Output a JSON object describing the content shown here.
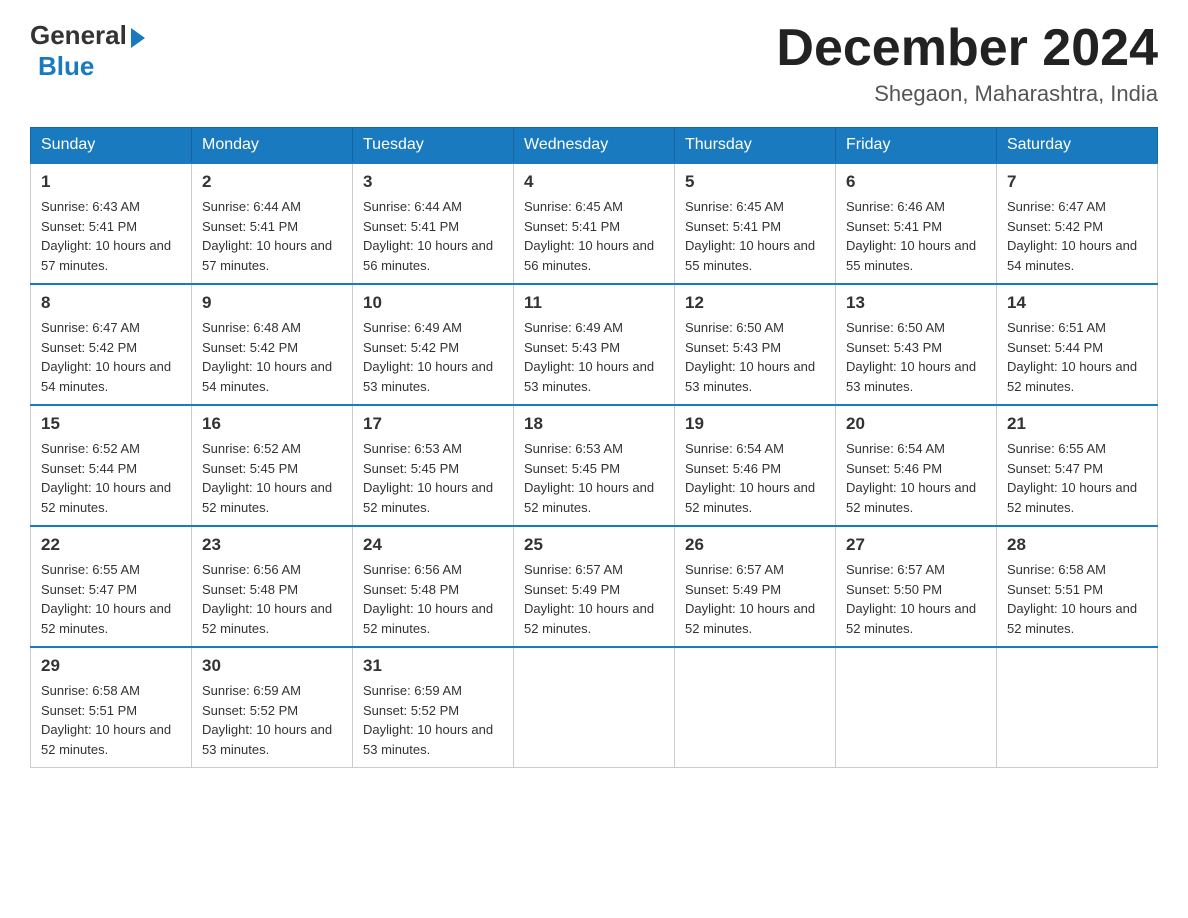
{
  "header": {
    "logo_general": "General",
    "logo_blue": "Blue",
    "title": "December 2024",
    "location": "Shegaon, Maharashtra, India"
  },
  "weekdays": [
    "Sunday",
    "Monday",
    "Tuesday",
    "Wednesday",
    "Thursday",
    "Friday",
    "Saturday"
  ],
  "weeks": [
    [
      {
        "day": "1",
        "sunrise": "6:43 AM",
        "sunset": "5:41 PM",
        "daylight": "10 hours and 57 minutes."
      },
      {
        "day": "2",
        "sunrise": "6:44 AM",
        "sunset": "5:41 PM",
        "daylight": "10 hours and 57 minutes."
      },
      {
        "day": "3",
        "sunrise": "6:44 AM",
        "sunset": "5:41 PM",
        "daylight": "10 hours and 56 minutes."
      },
      {
        "day": "4",
        "sunrise": "6:45 AM",
        "sunset": "5:41 PM",
        "daylight": "10 hours and 56 minutes."
      },
      {
        "day": "5",
        "sunrise": "6:45 AM",
        "sunset": "5:41 PM",
        "daylight": "10 hours and 55 minutes."
      },
      {
        "day": "6",
        "sunrise": "6:46 AM",
        "sunset": "5:41 PM",
        "daylight": "10 hours and 55 minutes."
      },
      {
        "day": "7",
        "sunrise": "6:47 AM",
        "sunset": "5:42 PM",
        "daylight": "10 hours and 54 minutes."
      }
    ],
    [
      {
        "day": "8",
        "sunrise": "6:47 AM",
        "sunset": "5:42 PM",
        "daylight": "10 hours and 54 minutes."
      },
      {
        "day": "9",
        "sunrise": "6:48 AM",
        "sunset": "5:42 PM",
        "daylight": "10 hours and 54 minutes."
      },
      {
        "day": "10",
        "sunrise": "6:49 AM",
        "sunset": "5:42 PM",
        "daylight": "10 hours and 53 minutes."
      },
      {
        "day": "11",
        "sunrise": "6:49 AM",
        "sunset": "5:43 PM",
        "daylight": "10 hours and 53 minutes."
      },
      {
        "day": "12",
        "sunrise": "6:50 AM",
        "sunset": "5:43 PM",
        "daylight": "10 hours and 53 minutes."
      },
      {
        "day": "13",
        "sunrise": "6:50 AM",
        "sunset": "5:43 PM",
        "daylight": "10 hours and 53 minutes."
      },
      {
        "day": "14",
        "sunrise": "6:51 AM",
        "sunset": "5:44 PM",
        "daylight": "10 hours and 52 minutes."
      }
    ],
    [
      {
        "day": "15",
        "sunrise": "6:52 AM",
        "sunset": "5:44 PM",
        "daylight": "10 hours and 52 minutes."
      },
      {
        "day": "16",
        "sunrise": "6:52 AM",
        "sunset": "5:45 PM",
        "daylight": "10 hours and 52 minutes."
      },
      {
        "day": "17",
        "sunrise": "6:53 AM",
        "sunset": "5:45 PM",
        "daylight": "10 hours and 52 minutes."
      },
      {
        "day": "18",
        "sunrise": "6:53 AM",
        "sunset": "5:45 PM",
        "daylight": "10 hours and 52 minutes."
      },
      {
        "day": "19",
        "sunrise": "6:54 AM",
        "sunset": "5:46 PM",
        "daylight": "10 hours and 52 minutes."
      },
      {
        "day": "20",
        "sunrise": "6:54 AM",
        "sunset": "5:46 PM",
        "daylight": "10 hours and 52 minutes."
      },
      {
        "day": "21",
        "sunrise": "6:55 AM",
        "sunset": "5:47 PM",
        "daylight": "10 hours and 52 minutes."
      }
    ],
    [
      {
        "day": "22",
        "sunrise": "6:55 AM",
        "sunset": "5:47 PM",
        "daylight": "10 hours and 52 minutes."
      },
      {
        "day": "23",
        "sunrise": "6:56 AM",
        "sunset": "5:48 PM",
        "daylight": "10 hours and 52 minutes."
      },
      {
        "day": "24",
        "sunrise": "6:56 AM",
        "sunset": "5:48 PM",
        "daylight": "10 hours and 52 minutes."
      },
      {
        "day": "25",
        "sunrise": "6:57 AM",
        "sunset": "5:49 PM",
        "daylight": "10 hours and 52 minutes."
      },
      {
        "day": "26",
        "sunrise": "6:57 AM",
        "sunset": "5:49 PM",
        "daylight": "10 hours and 52 minutes."
      },
      {
        "day": "27",
        "sunrise": "6:57 AM",
        "sunset": "5:50 PM",
        "daylight": "10 hours and 52 minutes."
      },
      {
        "day": "28",
        "sunrise": "6:58 AM",
        "sunset": "5:51 PM",
        "daylight": "10 hours and 52 minutes."
      }
    ],
    [
      {
        "day": "29",
        "sunrise": "6:58 AM",
        "sunset": "5:51 PM",
        "daylight": "10 hours and 52 minutes."
      },
      {
        "day": "30",
        "sunrise": "6:59 AM",
        "sunset": "5:52 PM",
        "daylight": "10 hours and 53 minutes."
      },
      {
        "day": "31",
        "sunrise": "6:59 AM",
        "sunset": "5:52 PM",
        "daylight": "10 hours and 53 minutes."
      },
      null,
      null,
      null,
      null
    ]
  ]
}
